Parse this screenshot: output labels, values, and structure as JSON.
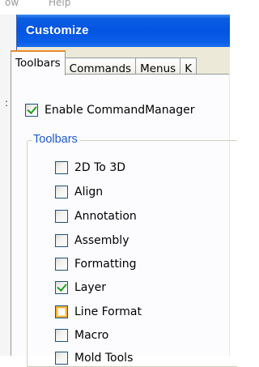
{
  "menubar": {
    "items": [
      "ow",
      "Help"
    ]
  },
  "dialog": {
    "title": "Customize",
    "tabs": [
      {
        "label": "Toolbars",
        "active": true
      },
      {
        "label": "Commands",
        "active": false
      },
      {
        "label": "Menus",
        "active": false
      },
      {
        "label": "K",
        "active": false
      }
    ],
    "enable_command_manager": {
      "label": "Enable CommandManager",
      "checked": true
    },
    "toolbars_group": {
      "legend": "Toolbars",
      "items": [
        {
          "label": "2D To 3D",
          "checked": false
        },
        {
          "label": "Align",
          "checked": false
        },
        {
          "label": "Annotation",
          "checked": false
        },
        {
          "label": "Assembly",
          "checked": false
        },
        {
          "label": "Formatting",
          "checked": false
        },
        {
          "label": "Layer",
          "checked": true
        },
        {
          "label": "Line Format",
          "checked": false,
          "hover": true
        },
        {
          "label": "Macro",
          "checked": false
        },
        {
          "label": "Mold Tools",
          "checked": false
        }
      ]
    }
  },
  "colors": {
    "titlebar": "#0554e3",
    "checkmark": "#21a121",
    "group_legend": "#1c5acc",
    "active_tab_highlight": "#e68b2c"
  }
}
